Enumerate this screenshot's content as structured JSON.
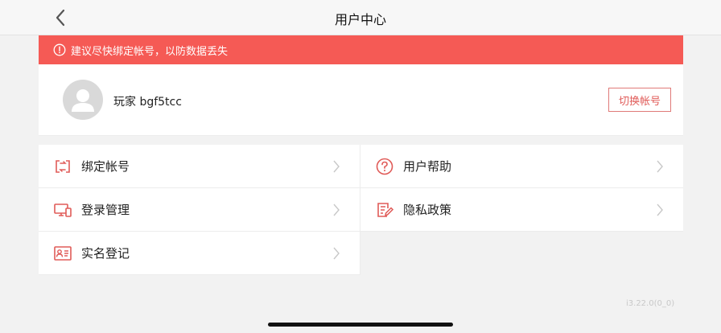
{
  "header": {
    "title": "用户中心"
  },
  "warning": {
    "text": "建议尽快绑定帐号，以防数据丢失"
  },
  "profile": {
    "name": "玩家 bgf5tcc",
    "switch_label": "切换帐号"
  },
  "menu": {
    "bind": "绑定帐号",
    "help": "用户帮助",
    "login_manage": "登录管理",
    "privacy": "隐私政策",
    "realname": "实名登记"
  },
  "footer": {
    "version": "i3.22.0(0_0)"
  },
  "colors": {
    "accent": "#f55a55",
    "icon": "#e05b58"
  }
}
